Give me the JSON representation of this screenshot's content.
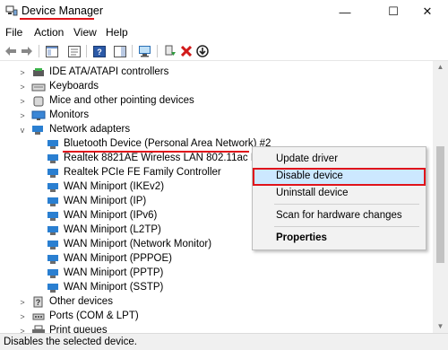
{
  "window": {
    "title": "Device Manager",
    "min_glyph": "—",
    "max_glyph": "☐",
    "close_glyph": "✕"
  },
  "menu": [
    "File",
    "Action",
    "View",
    "Help"
  ],
  "tree": {
    "items": [
      {
        "label": "IDE ATA/ATAPI controllers",
        "icon": "ide-controller-icon",
        "expander": ">"
      },
      {
        "label": "Keyboards",
        "icon": "keyboard-icon",
        "expander": ">"
      },
      {
        "label": "Mice and other pointing devices",
        "icon": "mouse-icon",
        "expander": ">"
      },
      {
        "label": "Monitors",
        "icon": "monitor-icon",
        "expander": ">"
      },
      {
        "label": "Network adapters",
        "icon": "network-adapter-icon",
        "expander": "v"
      },
      {
        "label": "Bluetooth Device (Personal Area Network) #2",
        "icon": "network-adapter-icon"
      },
      {
        "label": "Realtek 8821AE Wireless LAN 802.11ac PCI-E N",
        "icon": "network-adapter-icon"
      },
      {
        "label": "Realtek PCIe FE Family Controller",
        "icon": "network-adapter-icon"
      },
      {
        "label": "WAN Miniport (IKEv2)",
        "icon": "network-adapter-icon"
      },
      {
        "label": "WAN Miniport (IP)",
        "icon": "network-adapter-icon"
      },
      {
        "label": "WAN Miniport (IPv6)",
        "icon": "network-adapter-icon"
      },
      {
        "label": "WAN Miniport (L2TP)",
        "icon": "network-adapter-icon"
      },
      {
        "label": "WAN Miniport (Network Monitor)",
        "icon": "network-adapter-icon"
      },
      {
        "label": "WAN Miniport (PPPOE)",
        "icon": "network-adapter-icon"
      },
      {
        "label": "WAN Miniport (PPTP)",
        "icon": "network-adapter-icon"
      },
      {
        "label": "WAN Miniport (SSTP)",
        "icon": "network-adapter-icon"
      },
      {
        "label": "Other devices",
        "icon": "other-devices-icon",
        "expander": ">"
      },
      {
        "label": "Ports (COM & LPT)",
        "icon": "port-icon",
        "expander": ">"
      },
      {
        "label": "Print queues",
        "icon": "printer-icon",
        "expander": ">"
      }
    ]
  },
  "context_menu": {
    "items": [
      "Update driver",
      "Disable device",
      "Uninstall device",
      "Scan for hardware changes",
      "Properties"
    ]
  },
  "status": "Disables the selected device.",
  "colors": {
    "highlight_border": "#e0141b",
    "menu_highlight": "#cce8ff",
    "network_icon": "#2a7fd1"
  }
}
